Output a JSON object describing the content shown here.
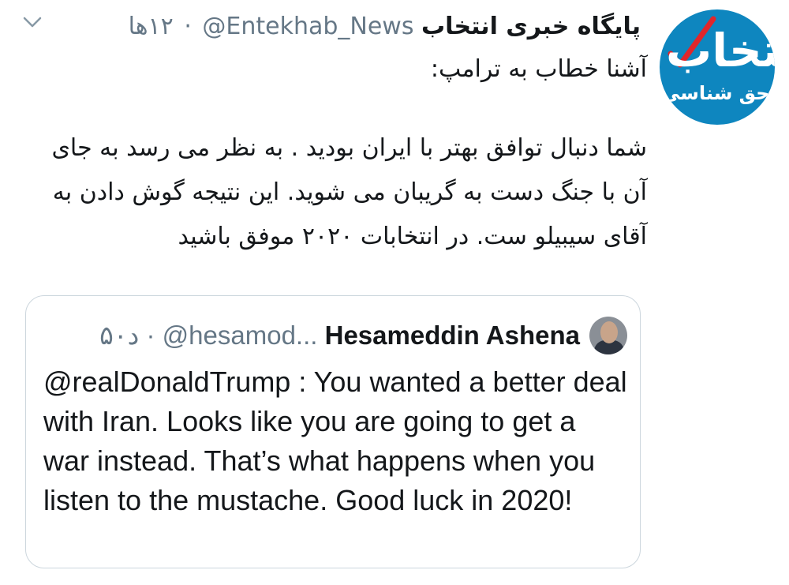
{
  "tweet": {
    "author_name": "پایگاه خبری انتخاب",
    "author_handle": "@Entekhab_News",
    "time": "۱۲ها",
    "separator": "·",
    "text_line1": "آشنا خطاب به ترامپ:",
    "text_body": "شما دنبال توافق بهتر با ایران بودید . به نظر می رسد به جای آن با جنگ دست به گریبان می شوید. این نتیجه گوش دادن به آقای سیبیلو ست. در انتخابات ۲۰۲۰ موفق باشید",
    "avatar_logo_text": "انتخاب",
    "avatar_logo_subtext": "حق شناسی"
  },
  "quoted": {
    "author_name": "Hesameddin Ashena",
    "author_handle": "@hesamod...",
    "separator": "·",
    "time": "۵۰د",
    "text": "@realDonaldTrump : You wanted a better deal with Iran. Looks like you are going to get a war instead. That’s what happens when you listen to the mustache. Good luck in 2020!"
  },
  "icons": {
    "menu": "chevron-down-icon",
    "logo": "entekhab-logo",
    "quoted_avatar": "avatar"
  },
  "colors": {
    "text_primary": "#14171a",
    "text_secondary": "#657786",
    "logo_blue": "#0e86bf",
    "logo_check": "#e0262b",
    "card_border": "#ccd6dd"
  }
}
